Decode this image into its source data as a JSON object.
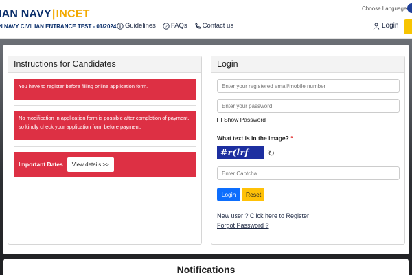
{
  "header": {
    "brand_navy": "IAN NAVY",
    "brand_sep": "|",
    "brand_incet": "INCET",
    "subtitle": "N NAVY CIVILIAN ENTRANCE TEST - 01/2024",
    "choose_language": "Choose Language :",
    "nav": [
      {
        "label": "Guidelines",
        "icon": "info-icon"
      },
      {
        "label": "FAQs",
        "icon": "question-icon"
      },
      {
        "label": "Contact us",
        "icon": "phone-icon"
      }
    ],
    "login_label": "Login",
    "login_icon": "user-icon"
  },
  "instructions": {
    "title": "Instructions for Candidates",
    "notice1": "You have to register before filling online application form.",
    "notice2": "No modification in application form is possible after completion of payment, so kindly check your application form before payment.",
    "important_dates": "Important Dates",
    "view_details": "View details >>"
  },
  "login": {
    "title": "Login",
    "email_placeholder": "Enter your registered email/mobile number",
    "password_placeholder": "Enter your password",
    "show_password": "Show Password",
    "captcha_question": "What text is in the image?",
    "captcha_required": "*",
    "captcha_text": "#r(lrf",
    "captcha_placeholder": "Enter Captcha",
    "login_button": "Login",
    "reset_button": "Reset",
    "new_user_link": "New user ? Click here to Register",
    "forgot_password_link": "Forgot Password ?"
  },
  "notifications": {
    "title": "Notifications"
  },
  "colors": {
    "navy": "#0b2f6b",
    "accent_yellow": "#f2a900",
    "notice_red": "#dd3044",
    "login_blue": "#0d6efd",
    "reset_yellow": "#ffc107"
  }
}
